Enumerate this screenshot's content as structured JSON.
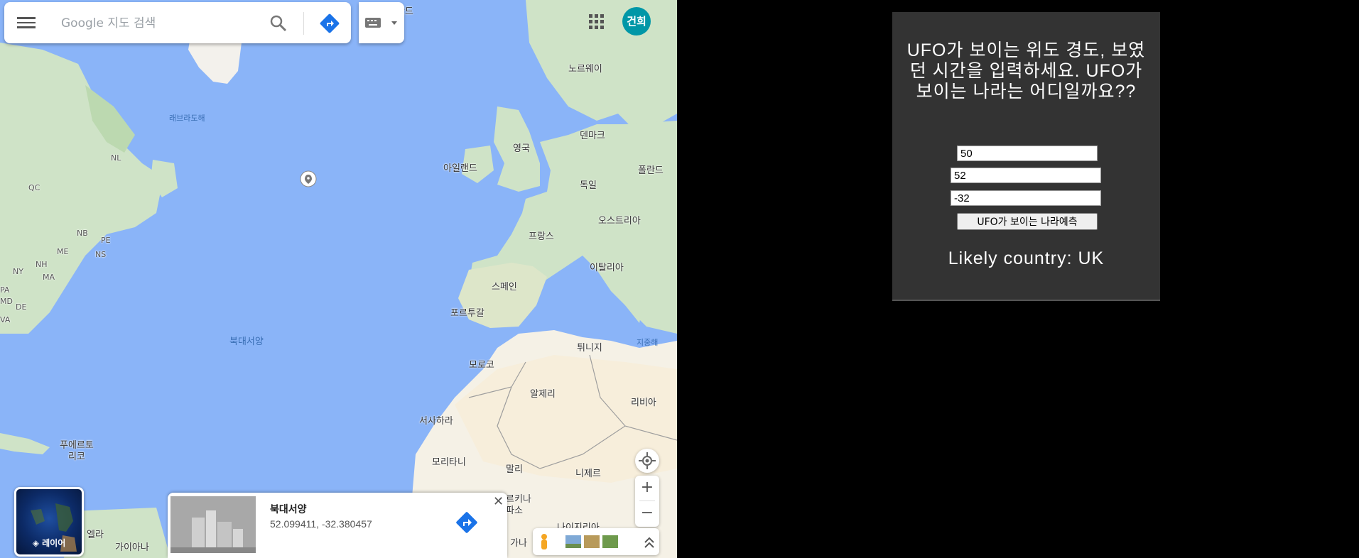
{
  "map": {
    "search_placeholder": "Google 지도 검색",
    "avatar_text": "건희",
    "labels": [
      {
        "name": "label-norway",
        "text": "노르웨이"
      },
      {
        "name": "label-labrador-sea",
        "text": "래브라도해"
      },
      {
        "name": "label-denmark",
        "text": "덴마크"
      },
      {
        "name": "label-uk",
        "text": "영국"
      },
      {
        "name": "label-ireland",
        "text": "아일랜드"
      },
      {
        "name": "label-poland",
        "text": "폴란드"
      },
      {
        "name": "label-germany",
        "text": "독일"
      },
      {
        "name": "label-austria",
        "text": "오스트리아"
      },
      {
        "name": "label-france",
        "text": "프랑스"
      },
      {
        "name": "label-italy",
        "text": "이탈리아"
      },
      {
        "name": "label-spain",
        "text": "스페인"
      },
      {
        "name": "label-portugal",
        "text": "포르투갈"
      },
      {
        "name": "label-north-atlantic",
        "text": "북대서양"
      },
      {
        "name": "label-mediterranean",
        "text": "지중해"
      },
      {
        "name": "label-tunisia",
        "text": "튀니지"
      },
      {
        "name": "label-morocco",
        "text": "모로코"
      },
      {
        "name": "label-algeria",
        "text": "알제리"
      },
      {
        "name": "label-libya",
        "text": "리비아"
      },
      {
        "name": "label-western-sahara",
        "text": "서사하라"
      },
      {
        "name": "label-mauritania",
        "text": "모리타니"
      },
      {
        "name": "label-mali",
        "text": "말리"
      },
      {
        "name": "label-niger",
        "text": "니제르"
      },
      {
        "name": "label-nigeria",
        "text": "나이지리아"
      },
      {
        "name": "label-puerto-rico",
        "text": "푸에르토\n리코"
      },
      {
        "name": "label-burkina",
        "text": "르키나\n파소"
      },
      {
        "name": "label-ghana",
        "text": "가나"
      },
      {
        "name": "label-guyana",
        "text": "가이아나"
      },
      {
        "name": "label-venezuela",
        "text": "엘라"
      },
      {
        "name": "label-nl",
        "text": "NL"
      },
      {
        "name": "label-qc",
        "text": "QC"
      },
      {
        "name": "label-nb",
        "text": "NB"
      },
      {
        "name": "label-pe",
        "text": "PE"
      },
      {
        "name": "label-ns",
        "text": "NS"
      },
      {
        "name": "label-me",
        "text": "ME"
      },
      {
        "name": "label-nh",
        "text": "NH"
      },
      {
        "name": "label-ny",
        "text": "NY"
      },
      {
        "name": "label-ma",
        "text": "MA"
      },
      {
        "name": "label-de",
        "text": "DE"
      },
      {
        "name": "label-pa",
        "text": "PA"
      },
      {
        "name": "label-md",
        "text": "MD"
      },
      {
        "name": "label-va",
        "text": "VA"
      },
      {
        "name": "label-greenland-top",
        "text": "란드"
      }
    ],
    "place_card": {
      "name": "북대서양",
      "coords": "52.099411, -32.380457"
    },
    "layers_label": "레이어"
  },
  "panel": {
    "title": "UFO가 보이는 위도 경도, 보였던 시간을 입력하세요. UFO가 보이는 나라는 어디일까요??",
    "lat_value": "50",
    "lon_value": "52",
    "time_value": "-32",
    "predict_label": "UFO가 보이는 나라예측",
    "result": "Likely country: UK"
  }
}
